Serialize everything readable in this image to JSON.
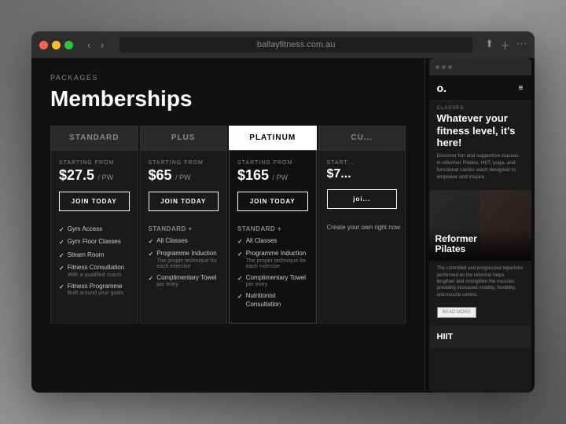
{
  "browser": {
    "address": "ballayfitness.com.au",
    "nav_back": "‹",
    "nav_forward": "›"
  },
  "packages": {
    "section_label": "PACKAGES",
    "page_title": "Memberships",
    "tabs": [
      {
        "id": "standard",
        "label": "STANDARD",
        "active": false
      },
      {
        "id": "plus",
        "label": "PLUS",
        "active": false
      },
      {
        "id": "platinum",
        "label": "PLATINUM",
        "active": true
      },
      {
        "id": "custom",
        "label": "CU...",
        "active": false
      }
    ],
    "columns": [
      {
        "id": "standard",
        "starting_from": "STARTING FROM",
        "price": "$27.5",
        "period": "/ PW",
        "join_label": "JOIN TODAY",
        "features_header": "",
        "features": [
          {
            "text": "Gym Access",
            "sub": ""
          },
          {
            "text": "Gym Floor Classes",
            "sub": ""
          },
          {
            "text": "Steam Room",
            "sub": ""
          },
          {
            "text": "Fitness Consultation",
            "sub": "With a qualified coach"
          },
          {
            "text": "Fitness Programme",
            "sub": "Built around your goals"
          }
        ]
      },
      {
        "id": "plus",
        "starting_from": "STARTING FROM",
        "price": "$65",
        "period": "/ PW",
        "join_label": "JOIN TODAY",
        "features_header": "STANDARD +",
        "features": [
          {
            "text": "All Classes",
            "sub": ""
          },
          {
            "text": "Programme Induction",
            "sub": "The proper technique for each exercise"
          },
          {
            "text": "Complimentary Towel",
            "sub": "per entry"
          }
        ]
      },
      {
        "id": "platinum",
        "starting_from": "STARTING FROM",
        "price": "$165",
        "period": "/ PW",
        "join_label": "JOIN TODAY",
        "features_header": "STANDARD +",
        "features": [
          {
            "text": "All Classes",
            "sub": ""
          },
          {
            "text": "Programme Induction",
            "sub": "The proper technique for each exercise"
          },
          {
            "text": "Complimentary Towel",
            "sub": "per entry"
          },
          {
            "text": "Nutritionist Consultation",
            "sub": ""
          }
        ]
      },
      {
        "id": "custom",
        "starting_from": "START...",
        "price": "$7...",
        "period": "",
        "join_label": "joi...",
        "features_header": "",
        "features": [
          {
            "text": "Create your own right now",
            "sub": ""
          }
        ]
      }
    ]
  },
  "mobile": {
    "logo": "o.",
    "menu_icon": "≡",
    "classes_label": "CLASSES",
    "hero_title": "Whatever your fitness level, it's here!",
    "hero_desc": "Discover fun and supportive classes in reformer Pilates, HIIT, yoga, and functional cardio–each designed to empower and inspire.",
    "reformer_card": {
      "title": "Reformer\nPilates",
      "description": "The controlled and progressive repertoire performed on the reformer helps lengthen and strengthen the muscles providing increased mobility, flexibility, and muscle control.",
      "read_more": "READ MORE"
    },
    "hiit_section": {
      "title": "HIIT"
    }
  }
}
